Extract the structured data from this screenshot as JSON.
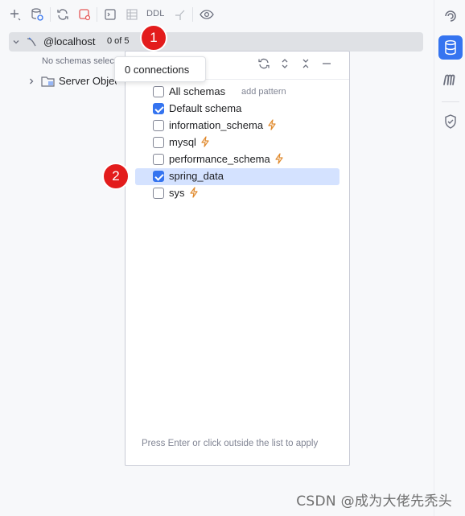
{
  "toolbar": {
    "ddl_label": "DDL"
  },
  "tree": {
    "host_label": "@localhost",
    "count_badge": "0 of 5",
    "no_schemas_text": "No schemas selected",
    "server_objects_label": "Server Objects"
  },
  "tooltip": {
    "text": "0 connections"
  },
  "popup": {
    "all_schemas": {
      "label": "All schemas",
      "checked": false
    },
    "add_pattern": "add pattern",
    "items": [
      {
        "label": "Default schema",
        "checked": true,
        "bolt": false,
        "selected": false
      },
      {
        "label": "information_schema",
        "checked": false,
        "bolt": true,
        "selected": false
      },
      {
        "label": "mysql",
        "checked": false,
        "bolt": true,
        "selected": false
      },
      {
        "label": "performance_schema",
        "checked": false,
        "bolt": true,
        "selected": false
      },
      {
        "label": "spring_data",
        "checked": true,
        "bolt": false,
        "selected": true
      },
      {
        "label": "sys",
        "checked": false,
        "bolt": true,
        "selected": false
      }
    ],
    "hint": "Press Enter or click outside the list to apply"
  },
  "annotations": {
    "badge_1": "1",
    "badge_2": "2"
  },
  "watermark": "CSDN @成为大佬先秃头",
  "colors": {
    "accent": "#3574f0",
    "selection": "#d4e2ff",
    "badge_red": "#e31c1c",
    "bolt_orange": "#e08a2e"
  },
  "icons": {
    "toolbar": [
      "plus-icon",
      "datasource-settings-icon",
      "refresh-icon",
      "stop-icon",
      "console-icon",
      "table-icon",
      "ddl-text",
      "jump-icon",
      "eye-icon"
    ],
    "right_strip": [
      "ai-swirl-icon",
      "database-icon",
      "m-icon",
      "shield-icon"
    ]
  }
}
